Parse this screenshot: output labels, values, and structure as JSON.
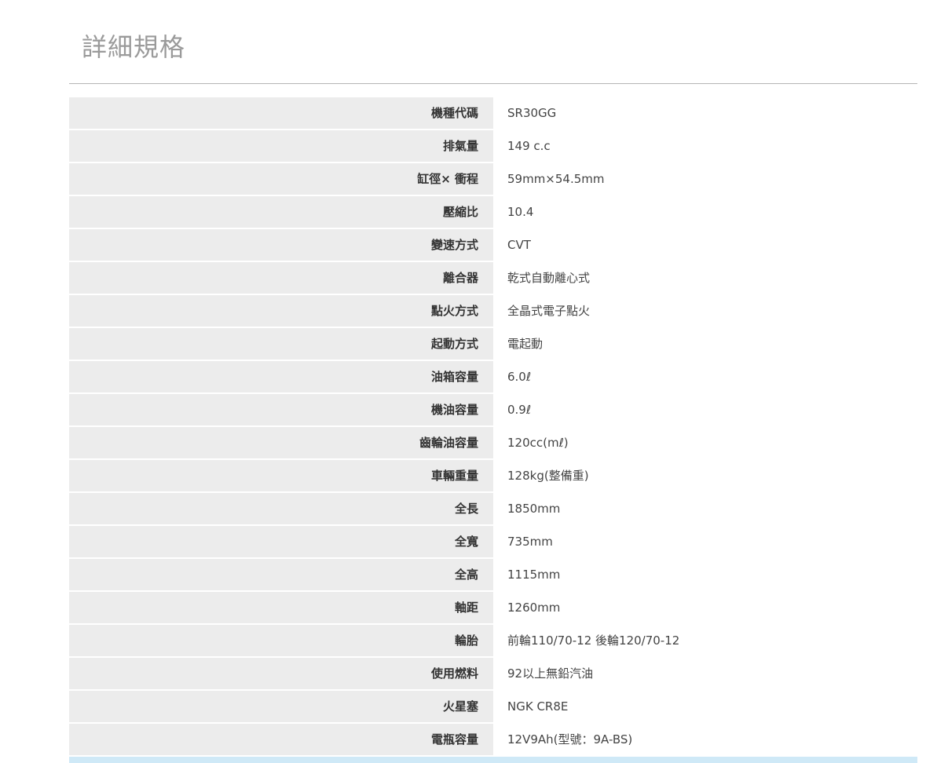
{
  "page": {
    "title": "詳細規格"
  },
  "specs": [
    {
      "label": "機種代碼",
      "value": "SR30GG"
    },
    {
      "label": "排氣量",
      "value": "149 c.c"
    },
    {
      "label": "缸徑× 衝程",
      "value": "59mm×54.5mm"
    },
    {
      "label": "壓縮比",
      "value": "10.4"
    },
    {
      "label": "變速方式",
      "value": "CVT"
    },
    {
      "label": "離合器",
      "value": "乾式自動離心式"
    },
    {
      "label": "點火方式",
      "value": "全晶式電子點火"
    },
    {
      "label": "起動方式",
      "value": "電起動"
    },
    {
      "label": "油箱容量",
      "value": "6.0ℓ"
    },
    {
      "label": "機油容量",
      "value": "0.9ℓ"
    },
    {
      "label": "齒輪油容量",
      "value": "120cc(mℓ)"
    },
    {
      "label": "車輛重量",
      "value": "128kg(整備重)"
    },
    {
      "label": "全長",
      "value": "1850mm"
    },
    {
      "label": "全寬",
      "value": "735mm"
    },
    {
      "label": "全高",
      "value": "1115mm"
    },
    {
      "label": "軸距",
      "value": "1260mm"
    },
    {
      "label": "輪胎",
      "value": "前輪110/70-12 後輪120/70-12"
    },
    {
      "label": "使用燃料",
      "value": "92以上無鉛汽油"
    },
    {
      "label": "火星塞",
      "value": "NGK CR8E"
    },
    {
      "label": "電瓶容量",
      "value": "12V9Ah(型號：9A-BS)"
    }
  ],
  "colors": {
    "title": "#9a9a9a",
    "label_bg": "#ececec",
    "divider": "#b5b5b5",
    "bottom_bar": "#cfe9f7"
  }
}
